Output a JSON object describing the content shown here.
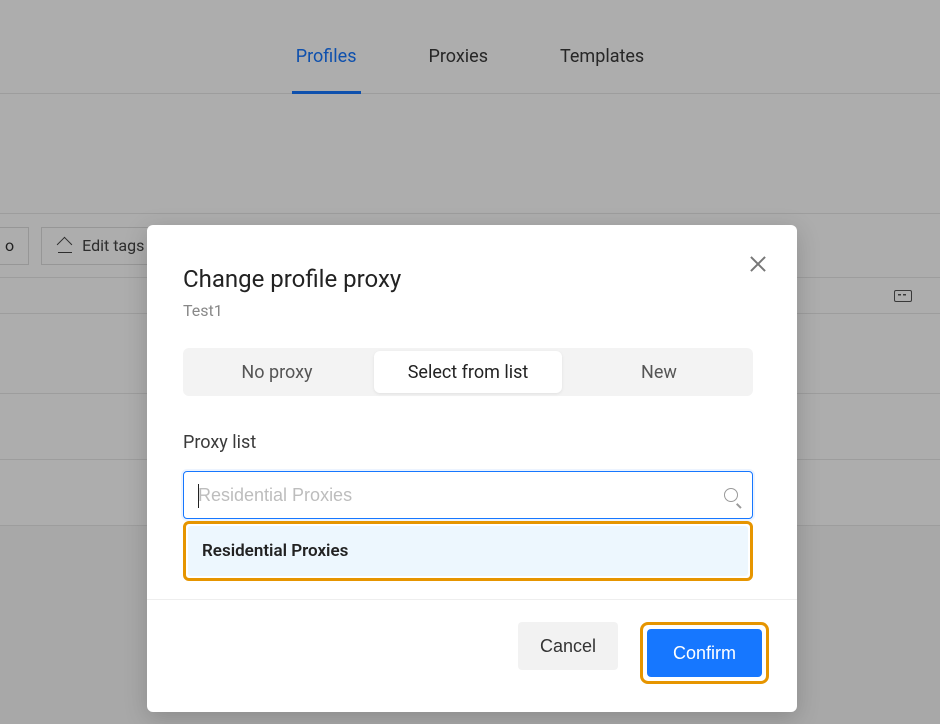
{
  "nav": {
    "tabs": [
      "Profiles",
      "Proxies",
      "Templates"
    ],
    "active_index": 0
  },
  "toolbar": {
    "frag_label": "o",
    "edit_tags_label": "Edit tags"
  },
  "modal": {
    "title": "Change profile proxy",
    "subtitle": "Test1",
    "segments": {
      "no_proxy": "No proxy",
      "select_from_list": "Select from list",
      "new": "New"
    },
    "section_label": "Proxy list",
    "search_placeholder": "Residential Proxies",
    "search_value": "",
    "dropdown": {
      "option_label": "Residential Proxies"
    },
    "buttons": {
      "cancel": "Cancel",
      "confirm": "Confirm"
    }
  },
  "icons": {
    "close": "close-icon",
    "search": "search-icon",
    "keyboard": "keyboard-icon",
    "edit": "edit-icon"
  },
  "colors": {
    "primary": "#1677ff",
    "highlight": "#e69500",
    "option_bg": "#edf7fe"
  }
}
